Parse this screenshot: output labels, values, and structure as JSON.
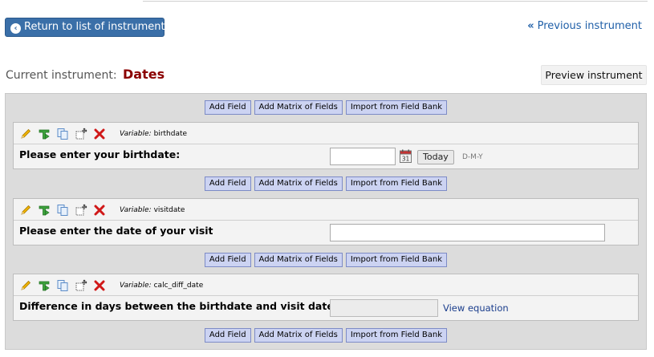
{
  "header": {
    "return_label": "Return to list of instruments",
    "previous_label": "Previous instrument",
    "current_label": "Current instrument:",
    "instrument_name": "Dates",
    "preview_label": "Preview instrument"
  },
  "add_buttons": {
    "add_field": "Add Field",
    "add_matrix": "Add Matrix of Fields",
    "import_bank": "Import from Field Bank"
  },
  "variable_prefix": "Variable:",
  "fields": [
    {
      "variable": "birthdate",
      "label": "Please enter your birthdate:",
      "today_label": "Today",
      "date_format": "D-M-Y",
      "calendar_day": "31"
    },
    {
      "variable": "visitdate",
      "label": "Please enter the date of your visit"
    },
    {
      "variable": "calc_diff_date",
      "label": "Difference in days between the birthdate and visit date",
      "view_equation": "View equation"
    }
  ],
  "icons": [
    "pencil-icon",
    "branching-logic-icon",
    "copy-icon",
    "move-icon",
    "delete-icon",
    "calendar-icon",
    "circle-arrow-left-icon",
    "double-chevron-left-icon"
  ],
  "colors": {
    "primary_button": "#3a6fa8",
    "instrument_name": "#8b0000",
    "add_button_bg": "#ccd3f2",
    "link": "#1f5fa8"
  }
}
